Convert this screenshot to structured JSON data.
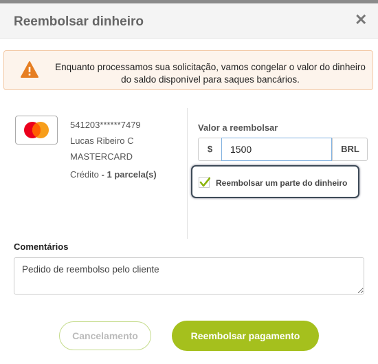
{
  "dialog": {
    "title": "Reembolsar dinheiro",
    "close_icon": "close-icon"
  },
  "alert": {
    "icon": "warning-icon",
    "text": "Enquanto processamos sua solicitação, vamos congelar o valor do dinheiro do saldo disponível para saques bancários.",
    "color": "#e67e22"
  },
  "card": {
    "logo": "mastercard-logo",
    "number": "541203******7479",
    "holder": "Lucas Ribeiro C",
    "brand": "MASTERCARD",
    "type": "Crédito",
    "installments_sep": " - ",
    "installments": "1 parcela(s)"
  },
  "refund": {
    "label": "Valor a reembolsar",
    "currency_symbol": "$",
    "value": "1500",
    "currency": "BRL",
    "partial_label": "Reembolsar um parte do dinheiro",
    "partial_checked": true
  },
  "comments": {
    "label": "Comentários",
    "value": "Pedido de reembolso pelo cliente"
  },
  "actions": {
    "cancel_label": "Cancelamento",
    "refund_label": "Reembolsar pagamento"
  },
  "colors": {
    "primary": "#a5c01d",
    "warning": "#e67e22",
    "check": "#8cb40c"
  }
}
